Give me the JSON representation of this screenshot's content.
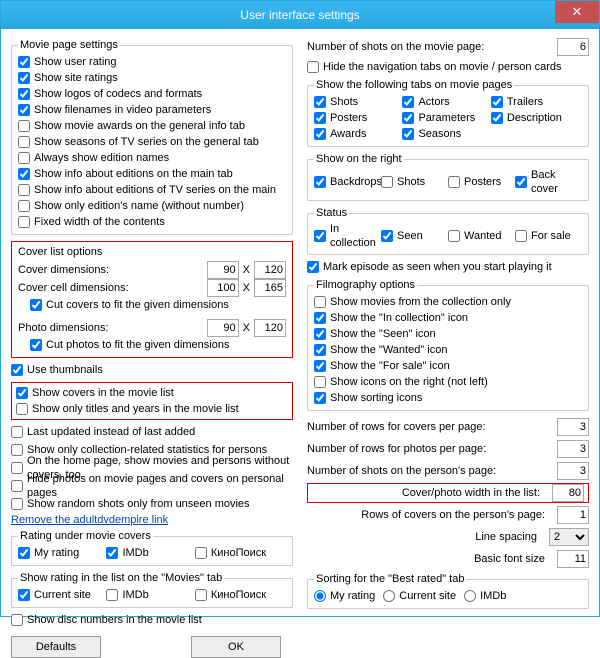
{
  "window": {
    "title": "User interface settings",
    "close": "✕"
  },
  "left": {
    "movie_page_group": "Movie page settings",
    "cbs": {
      "user_rating": "Show user rating",
      "site_ratings": "Show site ratings",
      "logos": "Show logos of codecs and formats",
      "filenames": "Show filenames in video parameters",
      "awards_general": "Show movie awards on the general info tab",
      "seasons_general": "Show seasons of TV series on the general tab",
      "edition_names": "Always show edition names",
      "editions_main": "Show info about editions on the main tab",
      "editions_tv": "Show info about editions of TV series on the main",
      "only_edition": "Show only edition's name (without number)",
      "fixed_width": "Fixed width of the contents"
    },
    "cover": {
      "group": "Cover list options",
      "cover_dim": "Cover dimensions:",
      "cover_w": "90",
      "cover_h": "120",
      "cell_dim": "Cover cell dimensions:",
      "cell_w": "100",
      "cell_h": "165",
      "cut_covers": "Cut covers to fit the given dimensions",
      "photo_dim": "Photo dimensions:",
      "photo_w": "90",
      "photo_h": "120",
      "cut_photos": "Cut photos to fit the given dimensions",
      "x": "X"
    },
    "thumbs": "Use thumbnails",
    "show_covers": "Show covers in the movie list",
    "only_titles": "Show only titles and years in the movie list",
    "last_updated": "Last updated instead of last added",
    "coll_stats": "Show only collection-related statistics for persons",
    "home_nocovers": "On the home page, show movies and persons without covers, too",
    "hide_photos": "Hide photos on movie pages and covers on personal pages",
    "random_unseen": "Show random shots only from unseen movies",
    "remove_link": "Remove the adultdvdempire link",
    "rating_group": "Rating under movie covers",
    "my_rating": "My rating",
    "imdb": "IMDb",
    "kino": "КиноПоиск",
    "rating_list_group": "Show rating in the list on the \"Movies\" tab",
    "current_site": "Current site",
    "disc_numbers": "Show disc numbers in the movie list",
    "defaults": "Defaults",
    "ok": "OK"
  },
  "right": {
    "shots_movie_lbl": "Number of shots on the movie page:",
    "shots_movie_val": "6",
    "hide_nav": "Hide the navigation tabs on movie / person cards",
    "tabs_group": "Show the following tabs on movie pages",
    "tabs": {
      "shots": "Shots",
      "actors": "Actors",
      "trailers": "Trailers",
      "posters": "Posters",
      "parameters": "Parameters",
      "description": "Description",
      "awards": "Awards",
      "seasons": "Seasons"
    },
    "right_group": "Show on the right",
    "rightopts": {
      "backdrops": "Backdrops",
      "shots": "Shots",
      "posters": "Posters",
      "back": "Back cover"
    },
    "status_group": "Status",
    "status": {
      "in_coll": "In collection",
      "seen": "Seen",
      "wanted": "Wanted",
      "for_sale": "For sale"
    },
    "mark_episode": "Mark episode as seen when you start playing it",
    "filmo_group": "Filmography options",
    "filmo": {
      "coll_only": "Show movies from the collection only",
      "incoll": "Show the \"In collection\" icon",
      "seen": "Show the \"Seen\" icon",
      "wanted": "Show the \"Wanted\" icon",
      "forsale": "Show the \"For sale\" icon",
      "icons_right": "Show icons on the right (not left)",
      "sorting": "Show sorting icons"
    },
    "rows_covers": "Number of rows for covers per page:",
    "rows_covers_v": "3",
    "rows_photos": "Number of rows for photos per page:",
    "rows_photos_v": "3",
    "shots_person": "Number of shots on the person's page:",
    "shots_person_v": "3",
    "cover_width": "Cover/photo width in the list:",
    "cover_width_v": "80",
    "rows_person": "Rows of covers on the person's page:",
    "rows_person_v": "1",
    "line_spacing": "Line spacing",
    "line_spacing_v": "2",
    "font_size": "Basic font size",
    "font_size_v": "11",
    "sort_group": "Sorting for the \"Best rated\" tab",
    "sort": {
      "my": "My rating",
      "site": "Current site",
      "imdb": "IMDb"
    }
  }
}
